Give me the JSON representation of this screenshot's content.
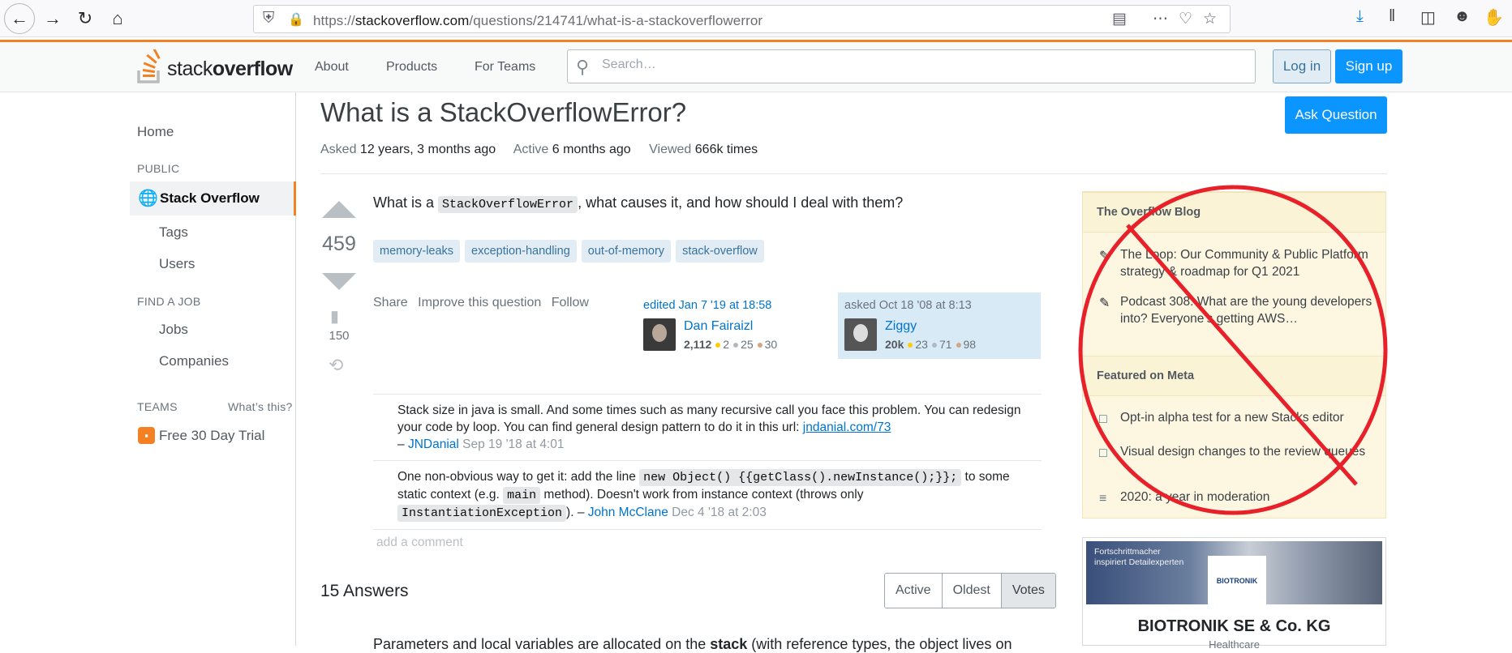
{
  "browser": {
    "url_prefix": "https://",
    "url_host": "stackoverflow.com",
    "url_path": "/questions/214741/what-is-a-stackoverflowerror"
  },
  "topbar": {
    "logo_light": "stack",
    "logo_bold": "overflow",
    "nav": [
      "About",
      "Products",
      "For Teams"
    ],
    "search_placeholder": "Search…",
    "login_label": "Log in",
    "signup_label": "Sign up"
  },
  "sidebar": {
    "home": "Home",
    "public_heading": "PUBLIC",
    "stack_overflow": "Stack Overflow",
    "tags": "Tags",
    "users": "Users",
    "job_heading": "FIND A JOB",
    "jobs": "Jobs",
    "companies": "Companies",
    "teams_heading": "TEAMS",
    "whats_this": "What’s this?",
    "trial": "Free 30 Day Trial"
  },
  "question": {
    "title": "What is a StackOverflowError?",
    "asked_label": "Asked",
    "asked_value": "12 years, 3 months ago",
    "active_label": "Active",
    "active_value": "6 months ago",
    "viewed_label": "Viewed",
    "viewed_value": "666k times",
    "ask_button": "Ask Question",
    "votes": "459",
    "bookmarks": "150",
    "body_pre": "What is a ",
    "body_code": "StackOverflowError",
    "body_post": ", what causes it, and how should I deal with them?",
    "tags": [
      "memory-leaks",
      "exception-handling",
      "out-of-memory",
      "stack-overflow"
    ],
    "menu": [
      "Share",
      "Improve this question",
      "Follow"
    ],
    "editor": {
      "action": "edited Jan 7 '19 at 18:58",
      "name": "Dan Fairaizl",
      "rep": "2,112",
      "gold": "2",
      "silver": "25",
      "bronze": "30"
    },
    "owner": {
      "action": "asked Oct 18 '08 at 8:13",
      "name": "Ziggy",
      "rep": "20k",
      "gold": "23",
      "silver": "71",
      "bronze": "98"
    }
  },
  "comments": {
    "c1_text": "Stack size in java is small. And some times such as many recursive call you face this problem. You can redesign your code by loop. You can find general design pattern to do it in this url: ",
    "c1_link": "jndanial.com/73",
    "c1_dash": "– ",
    "c1_user": "JNDanial",
    "c1_date": "Sep 19 '18 at 4:01",
    "c2_a": "One non-obvious way to get it: add the line ",
    "c2_code1": "new Object() {{getClass().newInstance();}};",
    "c2_b": " to some static context (e.g. ",
    "c2_code2": "main",
    "c2_c": " method). Doesn't work from instance context (throws only ",
    "c2_code3": "InstantiationException",
    "c2_d": "). – ",
    "c2_user": "John McClane",
    "c2_date": "Dec 4 '18 at 2:03",
    "add": "add a comment"
  },
  "answers": {
    "heading": "15 Answers",
    "sort": [
      "Active",
      "Oldest",
      "Votes"
    ],
    "peek_a": "Parameters and local variables are allocated on the ",
    "peek_b": "stack",
    "peek_c": " (with reference types, the object lives on"
  },
  "blog": {
    "heading": "The Overflow Blog",
    "item1": "The Loop: Our Community & Public Platform strategy & roadmap for Q1 2021",
    "item2": "Podcast 308: What are the young developers into? Everyone’s getting AWS…",
    "meta_heading": "Featured on Meta",
    "meta1": "Opt-in alpha test for a new Stacks editor",
    "meta2": "Visual design changes to the review queues",
    "meta3": "2020: a year in moderation"
  },
  "ad": {
    "slogan_1": "Fortschrittmacher",
    "slogan_2": "inspiriert Detailexperten",
    "logo": "BIOTRONIK",
    "name": "BIOTRONIK SE & Co. KG",
    "sub": "Healthcare"
  },
  "colors": {
    "accent": "#f48024",
    "link": "#0074cc",
    "primary_button": "#0a95ff",
    "prohibition_overlay": "#e8202a"
  }
}
